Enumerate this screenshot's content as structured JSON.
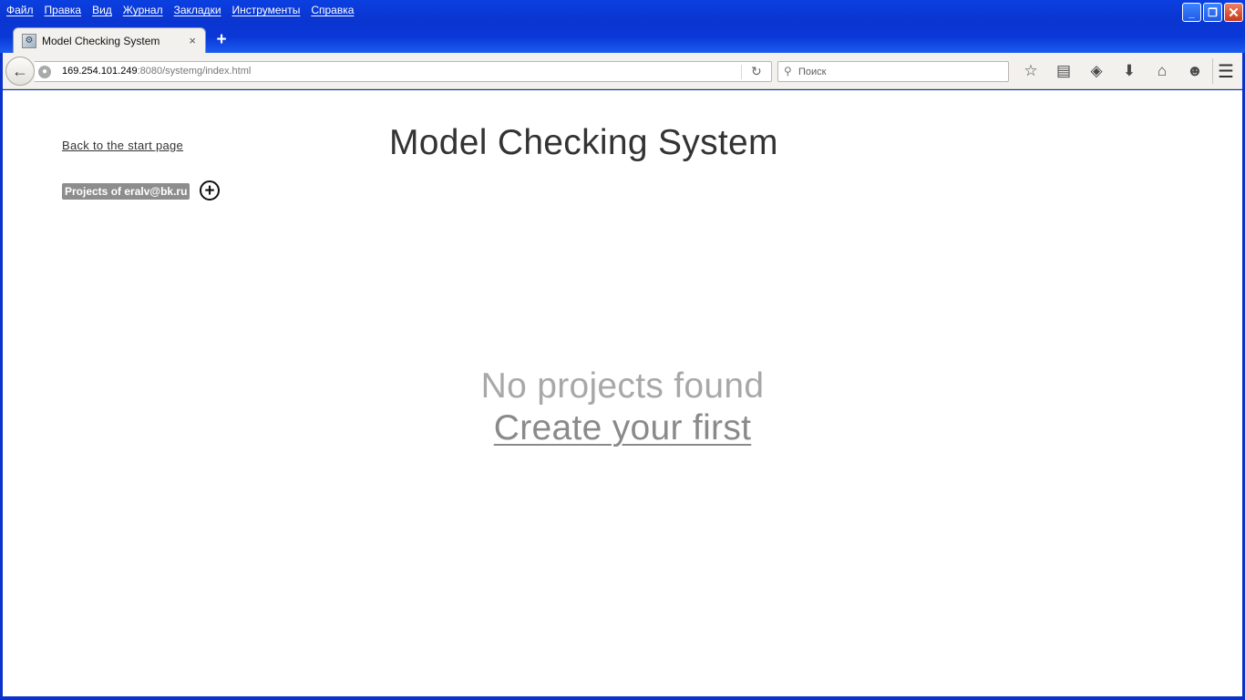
{
  "browser": {
    "menu": [
      "Файл",
      "Правка",
      "Вид",
      "Журнал",
      "Закладки",
      "Инструменты",
      "Справка"
    ],
    "window_controls": {
      "minimize": "_",
      "restore": "❐",
      "close": "✕"
    },
    "tab": {
      "title": "Model Checking System",
      "close_glyph": "×",
      "new_tab_glyph": "+"
    },
    "url": {
      "host": "169.254.101.249",
      "rest": ":8080/systemg/index.html"
    },
    "search": {
      "placeholder": "Поиск",
      "value": ""
    },
    "toolbar_icons": [
      "star-icon",
      "reading-list-icon",
      "pocket-icon",
      "download-icon",
      "home-icon",
      "smiley-icon"
    ]
  },
  "page": {
    "back_link": "Back to the start page",
    "title": "Model Checking System",
    "projects_badge": "Projects of eralv@bk.ru",
    "add_project_glyph": "+",
    "empty_message": "No projects found",
    "create_link": "Create your first"
  }
}
